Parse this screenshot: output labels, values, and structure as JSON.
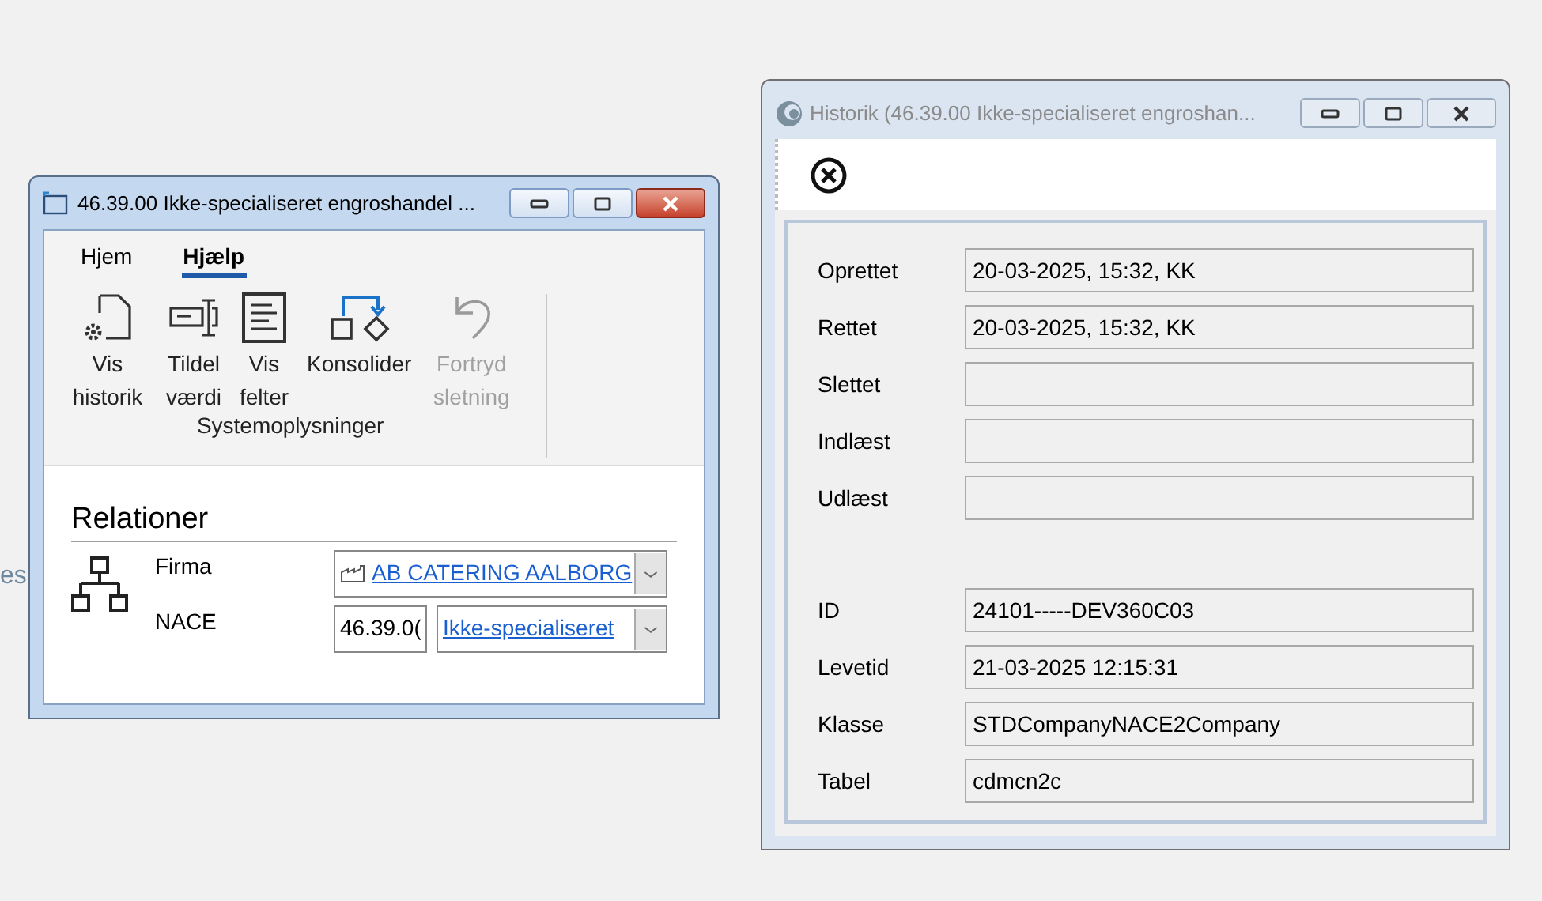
{
  "background_text": "es",
  "main_window": {
    "title": "46.39.00 Ikke-specialiseret engroshandel ...",
    "tabs": [
      {
        "label": "Hjem",
        "selected": false
      },
      {
        "label": "Hjælp",
        "selected": true
      }
    ],
    "ribbon_buttons": [
      {
        "kind": "history",
        "label": "Vis historik",
        "disabled": false
      },
      {
        "kind": "assign",
        "label": "Tildel værdi",
        "disabled": false
      },
      {
        "kind": "fields",
        "label": "Vis felter",
        "disabled": false
      },
      {
        "kind": "consolidate",
        "label": "Konsolider",
        "disabled": false
      },
      {
        "kind": "undo",
        "label": "Fortryd sletning",
        "disabled": true
      }
    ],
    "group_label": "Systemoplysninger",
    "section_title": "Relationer",
    "firma": {
      "label": "Firma",
      "value": "AB CATERING AALBORG"
    },
    "nace": {
      "label": "NACE",
      "code": "46.39.0(",
      "value": "Ikke-specialiseret"
    }
  },
  "history_window": {
    "title": "Historik (46.39.00 Ikke-specialiseret engroshan...",
    "fields": [
      {
        "label": "Oprettet",
        "value": "20-03-2025, 15:32, KK"
      },
      {
        "label": "Rettet",
        "value": "20-03-2025, 15:32, KK"
      },
      {
        "label": "Slettet"
      },
      {
        "label": "Indlæst"
      },
      {
        "label": "Udlæst"
      }
    ],
    "system_fields": [
      {
        "label": "ID",
        "value": "24101-----DEV360C03"
      },
      {
        "label": "Levetid",
        "value": "21-03-2025 12:15:31"
      },
      {
        "label": "Klasse",
        "value": "STDCompanyNACE2Company"
      },
      {
        "label": "Tabel",
        "value": "cdmcn2c"
      }
    ]
  }
}
